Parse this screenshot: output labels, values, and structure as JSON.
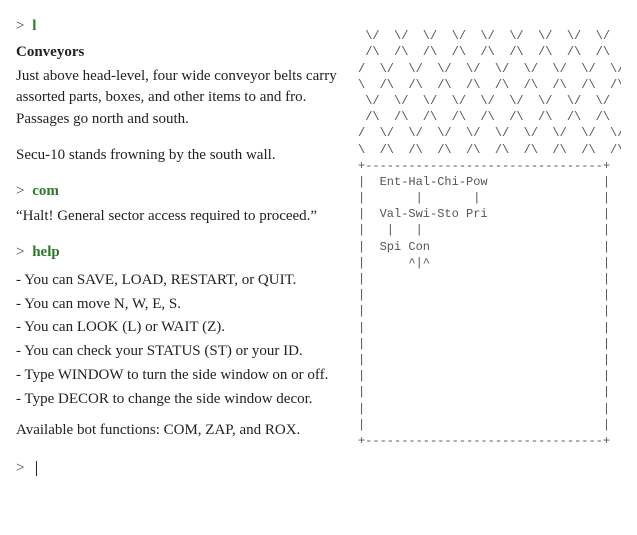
{
  "prompt_symbol": ">",
  "entries": [
    {
      "cmd": "l"
    }
  ],
  "room": {
    "title": "Conveyors",
    "desc": "Just above head-level, four wide conveyor belts carry assorted parts, boxes, and other items to and fro. Passages go north and south.",
    "extra": "Secu-10 stands frowning by the south wall."
  },
  "com_entry": {
    "cmd": "com"
  },
  "com_response": "“Halt! General sector access required to proceed.”",
  "help_entry": {
    "cmd": "help"
  },
  "help": {
    "items": [
      "- You can SAVE, LOAD, RESTART, or QUIT.",
      "- You can move N, W, E, S.",
      "- You can LOOK (L) or WAIT (Z).",
      "- You can check your STATUS (ST) or your ID.",
      "- Type WINDOW to turn the side window on or off.",
      "- Type DECOR to change the side window decor."
    ],
    "footer": "Available bot functions: COM, ZAP, and ROX."
  },
  "side_map": {
    "decor": [
      " \\/  \\/  \\/  \\/  \\/  \\/  \\/  \\/  \\/",
      " /\\  /\\  /\\  /\\  /\\  /\\  /\\  /\\  /\\",
      "/  \\/  \\/  \\/  \\/  \\/  \\/  \\/  \\/  \\/",
      "\\  /\\  /\\  /\\  /\\  /\\  /\\  /\\  /\\  /\\",
      " \\/  \\/  \\/  \\/  \\/  \\/  \\/  \\/  \\/  \\/",
      " /\\  /\\  /\\  /\\  /\\  /\\  /\\  /\\  /\\  /\\",
      "/  \\/  \\/  \\/  \\/  \\/  \\/  \\/  \\/  \\/",
      "\\  /\\  /\\  /\\  /\\  /\\  /\\  /\\  /\\  /\\"
    ],
    "frame": [
      "+---------------------------------+",
      "|  Ent-Hal-Chi-Pow                |",
      "|       |       |                 |",
      "|  Val-Swi-Sto Pri                |",
      "|   |   |                         |",
      "|  Spi Con                        |",
      "|      ^|^                        |",
      "|                                 |",
      "|                                 |",
      "|                                 |",
      "|                                 |",
      "|                                 |",
      "|                                 |",
      "|                                 |",
      "|                                 |",
      "|                                 |",
      "|                                 |",
      "+---------------------------------+"
    ]
  }
}
